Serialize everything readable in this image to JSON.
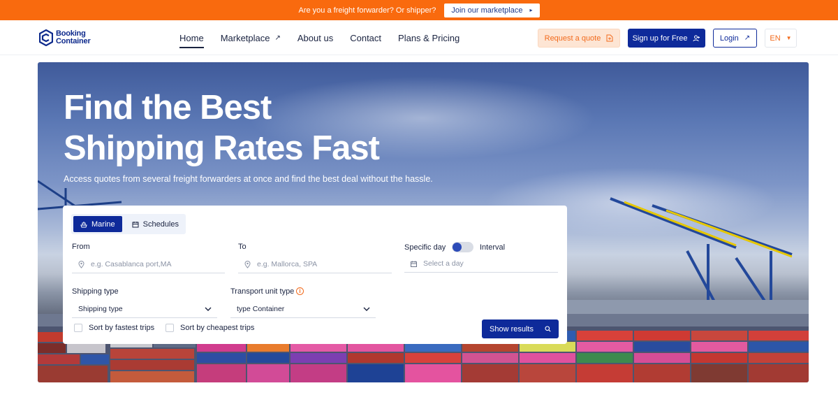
{
  "promo": {
    "text": "Are you a freight forwarder? Or shipper?",
    "button_label": "Join our marketplace"
  },
  "nav": {
    "logo_line1": "Booking",
    "logo_line2": "Container",
    "menu": [
      {
        "label": "Home",
        "active": true
      },
      {
        "label": "Marketplace",
        "external": true
      },
      {
        "label": "About us"
      },
      {
        "label": "Contact"
      },
      {
        "label": "Plans & Pricing"
      }
    ],
    "request_quote_label": "Request a quote",
    "signup_label": "Sign up for Free",
    "login_label": "Login",
    "language": "EN"
  },
  "hero": {
    "title_line1": "Find the Best",
    "title_line2": "Shipping Rates Fast",
    "subtitle": "Access quotes from several freight forwarders at once and find the best deal without the hassle."
  },
  "search": {
    "tabs": [
      {
        "label": "Marine",
        "icon": "ship-icon",
        "active": true
      },
      {
        "label": "Schedules",
        "icon": "calendar-icon",
        "active": false
      }
    ],
    "from_label": "From",
    "from_placeholder": "e.g. Casablanca port,MA",
    "to_label": "To",
    "to_placeholder": "e.g. Mallorca, SPA",
    "specific_day_label": "Specific day",
    "interval_label": "Interval",
    "date_placeholder": "Select a day",
    "shipping_type_label": "Shipping type",
    "shipping_type_value": "Shipping type",
    "transport_unit_label": "Transport unit type",
    "transport_unit_value": "type Container",
    "sort_fastest_label": "Sort by fastest trips",
    "sort_cheapest_label": "Sort by cheapest trips",
    "show_results_label": "Show results"
  },
  "colors": {
    "brand_blue": "#0e2a9a",
    "brand_orange": "#f96a0e"
  }
}
